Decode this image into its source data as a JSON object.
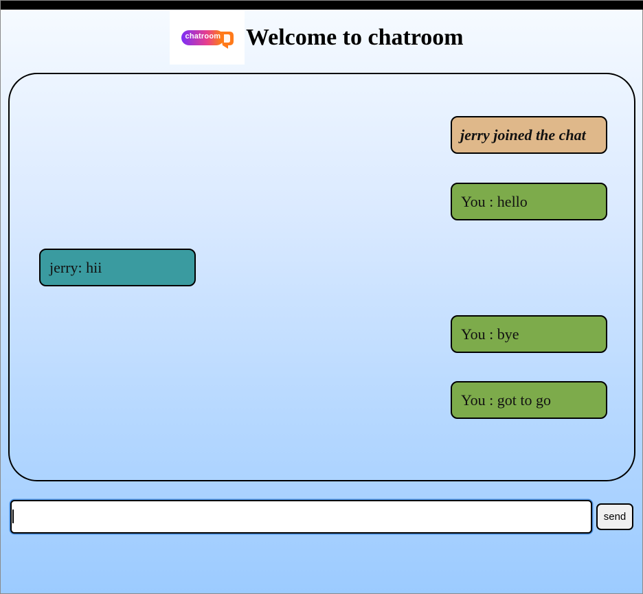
{
  "header": {
    "logo_text": "chatroom",
    "title": "Welcome to chatroom"
  },
  "colors": {
    "sent_bubble": "#7dab4b",
    "received_bubble": "#3a9ba0",
    "notice_bubble": "#dfb88a",
    "logo_gradient_start": "#7b2ff7",
    "logo_gradient_end": "#ff8a00"
  },
  "messages": [
    {
      "kind": "notice",
      "text": "jerry joined the chat"
    },
    {
      "kind": "sent",
      "text": "You : hello"
    },
    {
      "kind": "received",
      "text": "jerry: hii"
    },
    {
      "kind": "sent",
      "text": "You : bye"
    },
    {
      "kind": "sent",
      "text": "You : got to go"
    }
  ],
  "composer": {
    "input_value": "",
    "input_placeholder": "",
    "send_label": "send"
  }
}
